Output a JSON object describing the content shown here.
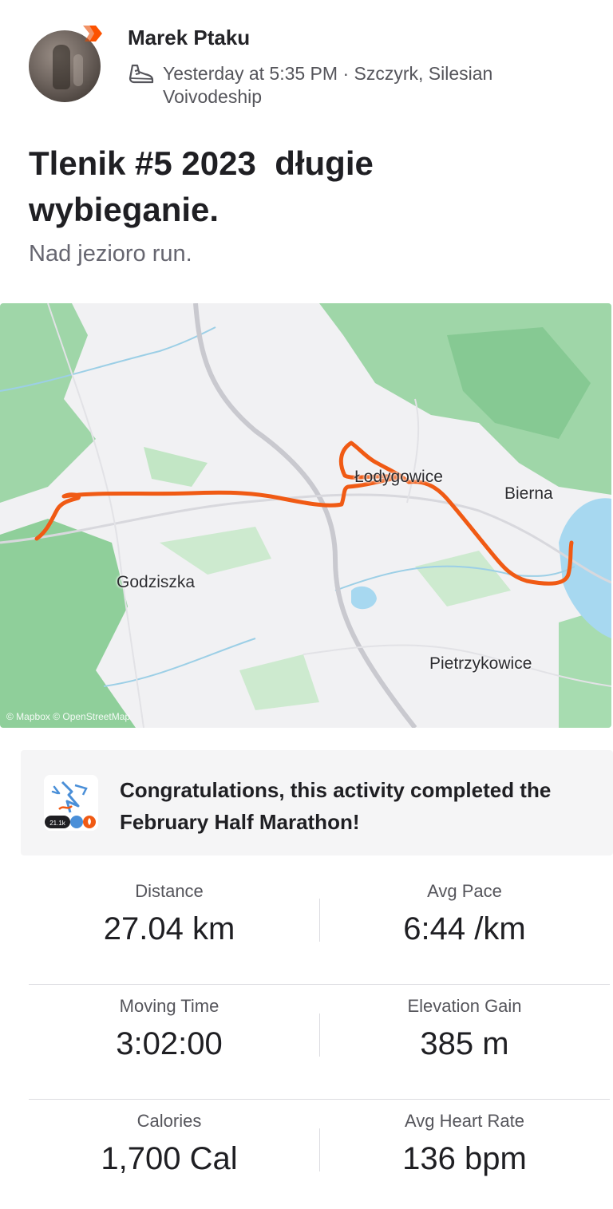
{
  "header": {
    "athlete_name": "Marek Ptaku",
    "activity_icon": "running-shoe-icon",
    "meta_text": "Yesterday at 5:35 PM · Szczyrk, Silesian Voivodeship"
  },
  "activity": {
    "title": "Tlenik #5 2023  długie\nwybieganie.",
    "description": "Nad jezioro run."
  },
  "map": {
    "labels": {
      "town_1": "Łodygowice",
      "town_2": "Bierna",
      "town_3": "Godziszka",
      "town_4": "Pietrzykowice"
    },
    "attribution": "© Mapbox © OpenStreetMap",
    "route_color": "#f05a14",
    "forest_color": "#8fcf9a",
    "water_color": "#a7d8f0"
  },
  "challenge": {
    "icon": "half-marathon-badge-icon",
    "badge_text": "21.1k",
    "text": "Congratulations, this activity completed the February Half Marathon!"
  },
  "stats": [
    {
      "left": {
        "label": "Distance",
        "value": "27.04 km"
      },
      "right": {
        "label": "Avg Pace",
        "value": "6:44 /km"
      }
    },
    {
      "left": {
        "label": "Moving Time",
        "value": "3:02:00"
      },
      "right": {
        "label": "Elevation Gain",
        "value": "385 m"
      }
    },
    {
      "left": {
        "label": "Calories",
        "value": "1,700 Cal"
      },
      "right": {
        "label": "Avg Heart Rate",
        "value": "136 bpm"
      }
    }
  ],
  "colors": {
    "brand": "#fc5200",
    "text_primary": "#242428",
    "text_secondary": "#55555b"
  }
}
